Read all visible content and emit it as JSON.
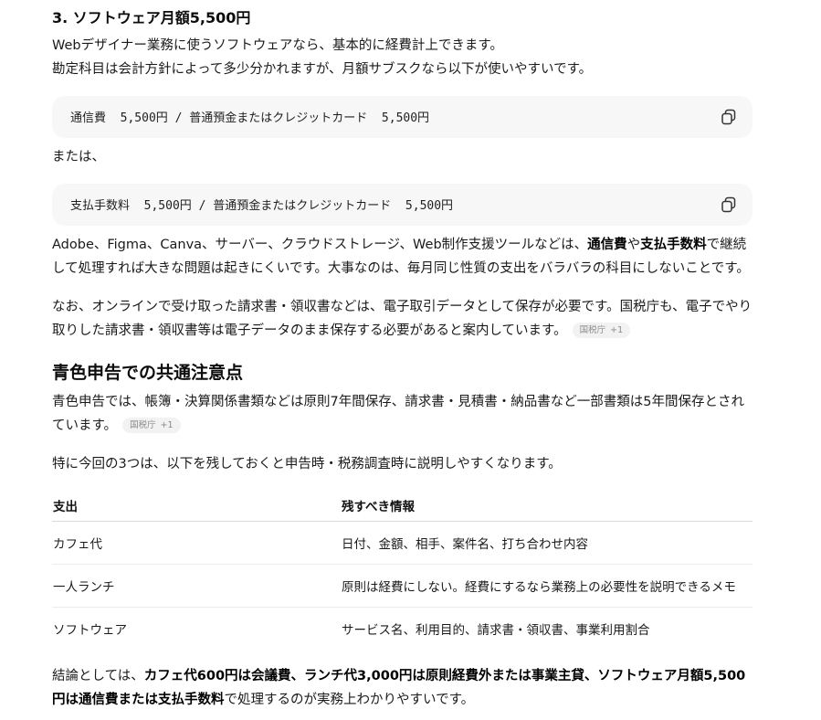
{
  "section3": {
    "heading": "3. ソフトウェア月額5,500円",
    "intro_line1": "Webデザイナー業務に使うソフトウェアなら、基本的に経費計上できます。",
    "intro_line2": "勘定科目は会計方針によって多少分かれますが、月額サブスクなら以下が使いやすいです。",
    "code1": "通信費  5,500円 / 普通預金またはクレジットカード  5,500円",
    "or_text": "または、",
    "code2": "支払手数料  5,500円 / 普通預金またはクレジットカード  5,500円",
    "para1_a": "Adobe、Figma、Canva、サーバー、クラウドストレージ、Web制作支援ツールなどは、",
    "para1_b1": "通信費",
    "para1_c": "や",
    "para1_b2": "支払手数料",
    "para1_d": "で継続して処理すれば大きな問題は起きにくいです。大事なのは、毎月同じ性質の支出をバラバラの科目にしないことです。",
    "para2": "なお、オンラインで受け取った請求書・領収書などは、電子取引データとして保存が必要です。国税庁も、電子でやり取りした請求書・領収書等は電子データのまま保存する必要があると案内しています。",
    "badge_label": "国税庁",
    "badge_count": "+1"
  },
  "common": {
    "heading": "青色申告での共通注意点",
    "para1": "青色申告では、帳簿・決算関係書類などは原則7年間保存、請求書・見積書・納品書など一部書類は5年間保存とされています。",
    "badge_label": "国税庁",
    "badge_count": "+1",
    "para2": "特に今回の3つは、以下を残しておくと申告時・税務調査時に説明しやすくなります。"
  },
  "table": {
    "headers": [
      "支出",
      "残すべき情報"
    ],
    "rows": [
      [
        "カフェ代",
        "日付、金額、相手、案件名、打ち合わせ内容"
      ],
      [
        "一人ランチ",
        "原則は経費にしない。経費にするなら業務上の必要性を説明できるメモ"
      ],
      [
        "ソフトウェア",
        "サービス名、利用目的、請求書・領収書、事業利用割合"
      ]
    ]
  },
  "conclusion": {
    "a": "結論としては、",
    "b": "カフェ代600円は会議費、ランチ代3,000円は原則経費外または事業主貸、ソフトウェア月額5,500円は通信費または支払手数料",
    "c": "で処理するのが実務上わかりやすいです。"
  },
  "icons": {
    "copy": "copy-icon"
  }
}
